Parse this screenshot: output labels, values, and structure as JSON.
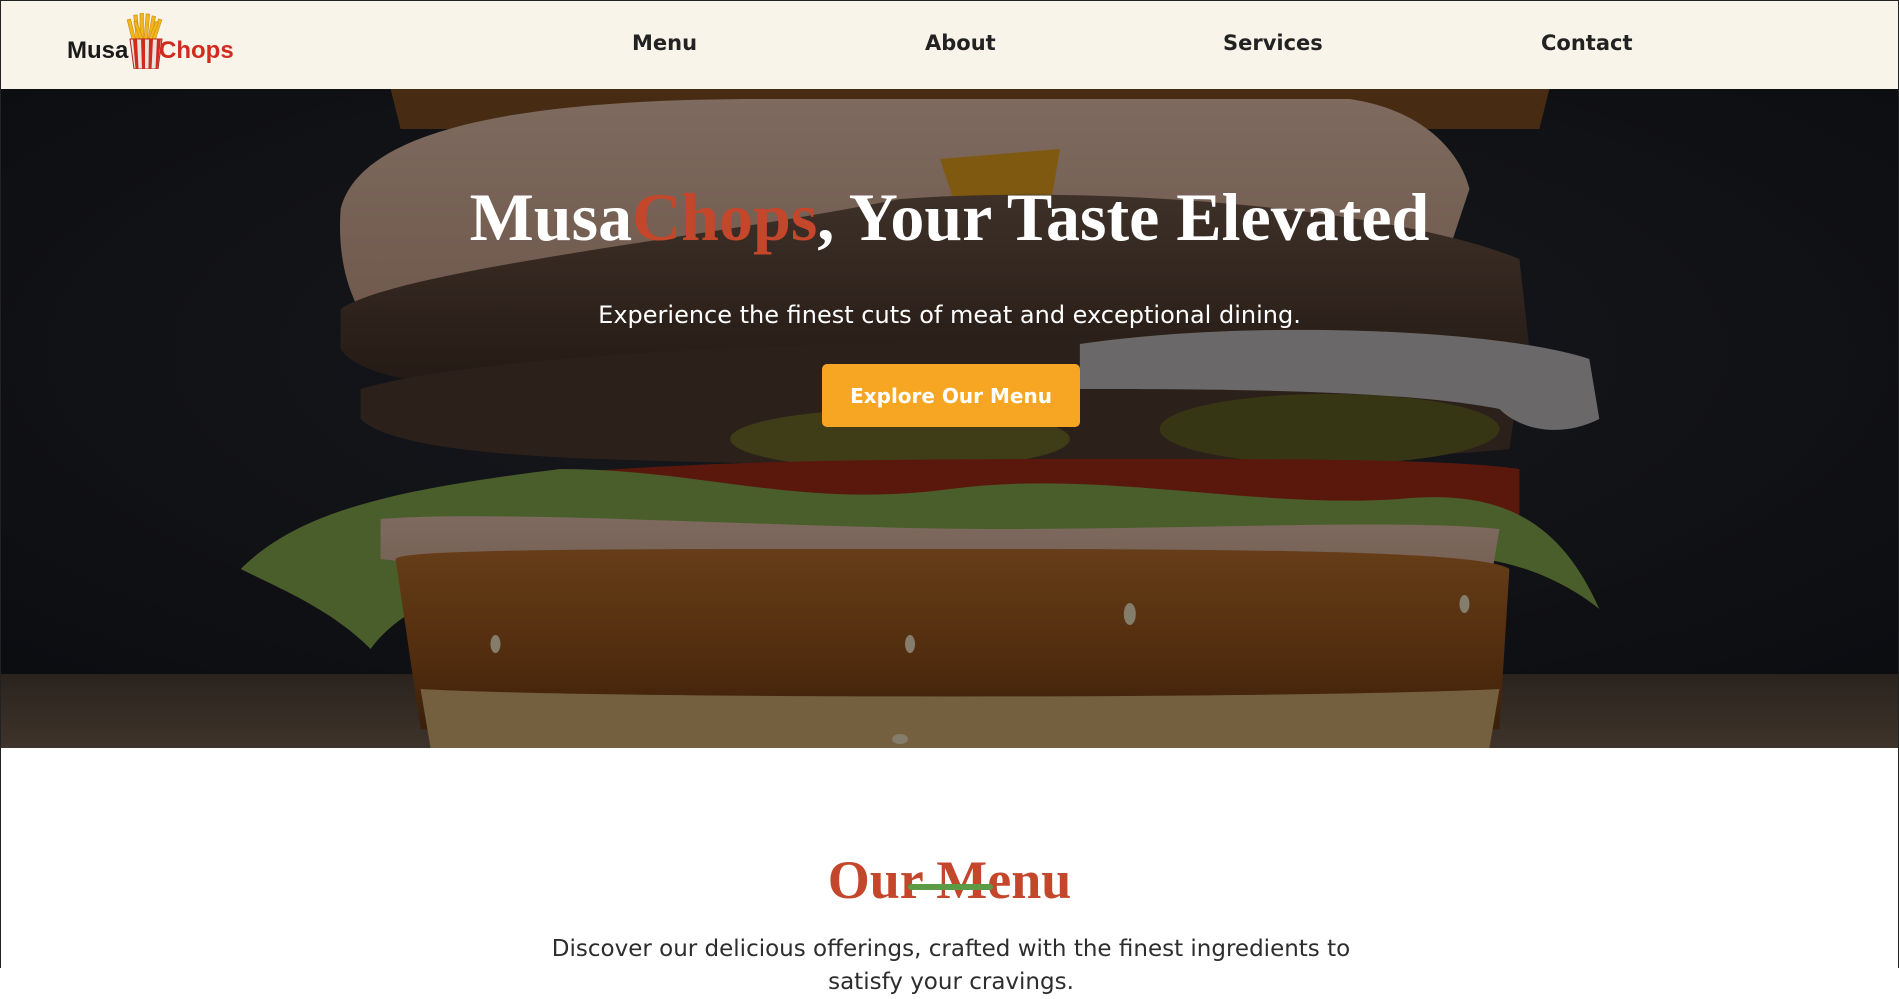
{
  "brand": {
    "name_part1": "Musa",
    "name_part2": "Chops",
    "primary_color": "#d12a1f",
    "accent_color": "#c4462b",
    "button_color": "#f6a623",
    "underline_color": "#5b9b45",
    "nav_background": "#f8f4ea",
    "logo_icon": "fries-icon"
  },
  "nav": {
    "items": [
      {
        "label": "Menu"
      },
      {
        "label": "About"
      },
      {
        "label": "Services"
      },
      {
        "label": "Contact"
      }
    ]
  },
  "hero": {
    "title_part1": "Musa",
    "title_accent": "Chops",
    "title_part2": ", Your Taste Elevated",
    "subtitle": "Experience the finest cuts of meat and exceptional dining.",
    "cta_label": "Explore Our Menu",
    "background": "burger-photo"
  },
  "menu_section": {
    "title": "Our Menu",
    "description": "Discover our delicious offerings, crafted with the finest ingredients to satisfy your cravings."
  }
}
